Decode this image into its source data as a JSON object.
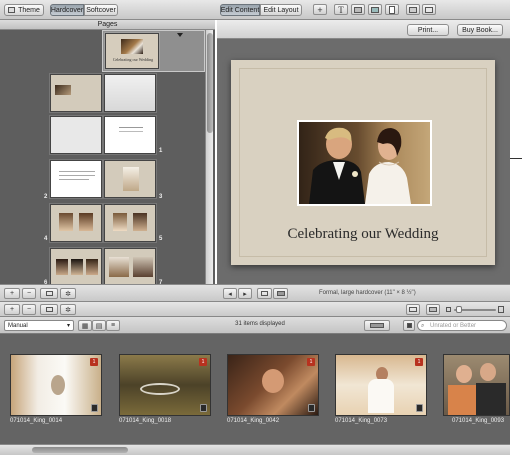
{
  "toolbar": {
    "theme_label": "Theme",
    "hardcover_label": "Hardcover",
    "softcover_label": "Softcover",
    "edit_content_label": "Edit Content",
    "edit_layout_label": "Edit Layout",
    "add_symbol": "+",
    "text_symbol": "T"
  },
  "pages_panel": {
    "header": "Pages",
    "page_numbers": [
      "1",
      "2",
      "3",
      "4",
      "5",
      "6",
      "7"
    ]
  },
  "editor": {
    "print_label": "Print...",
    "buy_book_label": "Buy Book...",
    "page_title": "Celebrating our Wedding",
    "book_info": "Formal, large hardcover (11\" × 8 ½\")",
    "book_cover_thumb_text": "Celebrating our Wedding"
  },
  "browser_bar": {
    "sort_value": "Manual",
    "items_displayed": "31 items displayed",
    "rating_filter_placeholder": "Unrated or Better"
  },
  "browser": {
    "items": [
      {
        "name": "071014_King_0014",
        "badge": "1"
      },
      {
        "name": "071014_King_0018",
        "badge": "1"
      },
      {
        "name": "071014_King_0042",
        "badge": "1"
      },
      {
        "name": "071014_King_0073",
        "badge": "1"
      },
      {
        "name": "071014_King_0093",
        "badge": ""
      }
    ]
  },
  "colors": {
    "page_background": "#d9d1c1",
    "pane_background": "#5e5e5e",
    "badge": "#b8321f"
  }
}
